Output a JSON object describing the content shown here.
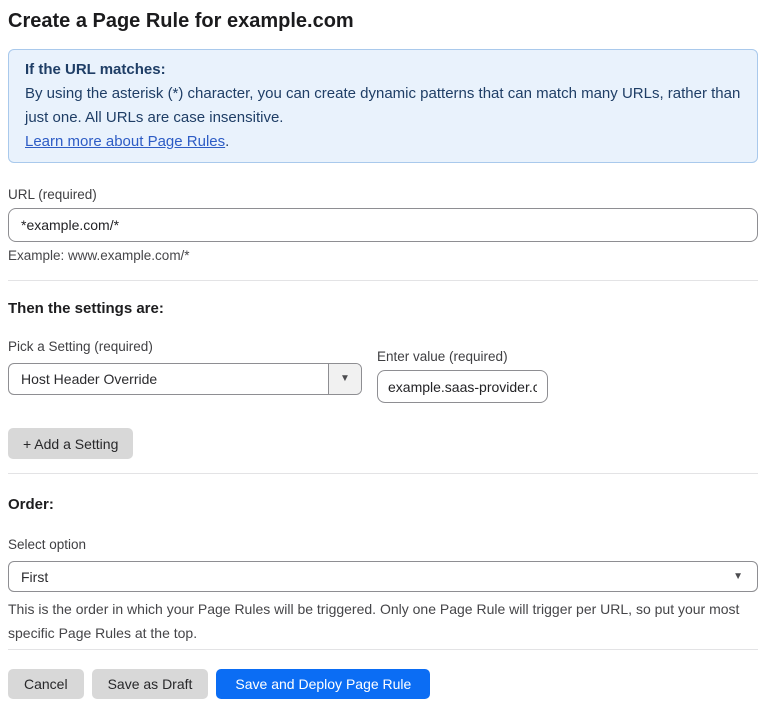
{
  "page": {
    "title": "Create a Page Rule for example.com"
  },
  "info_box": {
    "heading": "If the URL matches:",
    "body": "By using the asterisk (*) character, you can create dynamic patterns that can match many URLs, rather than just one. All URLs are case insensitive.",
    "link_text": "Learn more about Page Rules",
    "link_suffix": "."
  },
  "url_field": {
    "label": "URL (required)",
    "value": "*example.com/*",
    "helper": "Example: www.example.com/*"
  },
  "settings": {
    "heading": "Then the settings are:",
    "setting_label": "Pick a Setting (required)",
    "setting_selected": "Host Header Override",
    "value_label": "Enter value (required)",
    "value_text": "example.saas-provider.c",
    "add_button_label": "+ Add a Setting"
  },
  "order": {
    "heading": "Order:",
    "select_label": "Select option",
    "selected_option": "First",
    "helper": "This is the order in which your Page Rules will be triggered. Only one Page Rule will trigger per URL, so put your most specific Page Rules at the top."
  },
  "footer": {
    "cancel_label": "Cancel",
    "save_draft_label": "Save as Draft",
    "save_deploy_label": "Save and Deploy Page Rule"
  },
  "icons": {
    "dropdown_arrow": "▼"
  },
  "colors": {
    "info_background": "#e9f2fc",
    "info_border": "#a9c9ec",
    "info_text": "#1f3e66",
    "link": "#2d5cc5",
    "primary_button": "#0b6df4",
    "secondary_button": "#d8d8d8"
  }
}
